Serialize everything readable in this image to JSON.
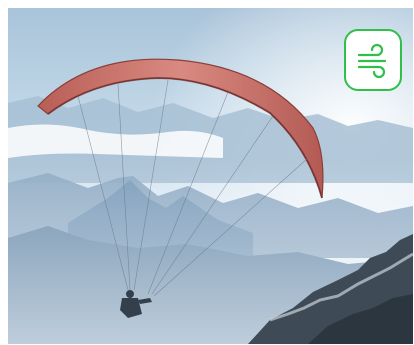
{
  "photo": {
    "subject": "paraglider",
    "colors": {
      "sky": "#b9d1e3",
      "wing": "#c8736b",
      "mountain": "#7f9fbc",
      "rock": "#3e4a55"
    }
  },
  "badge": {
    "icon": "wind-icon",
    "accent": "#2fbf4a"
  }
}
